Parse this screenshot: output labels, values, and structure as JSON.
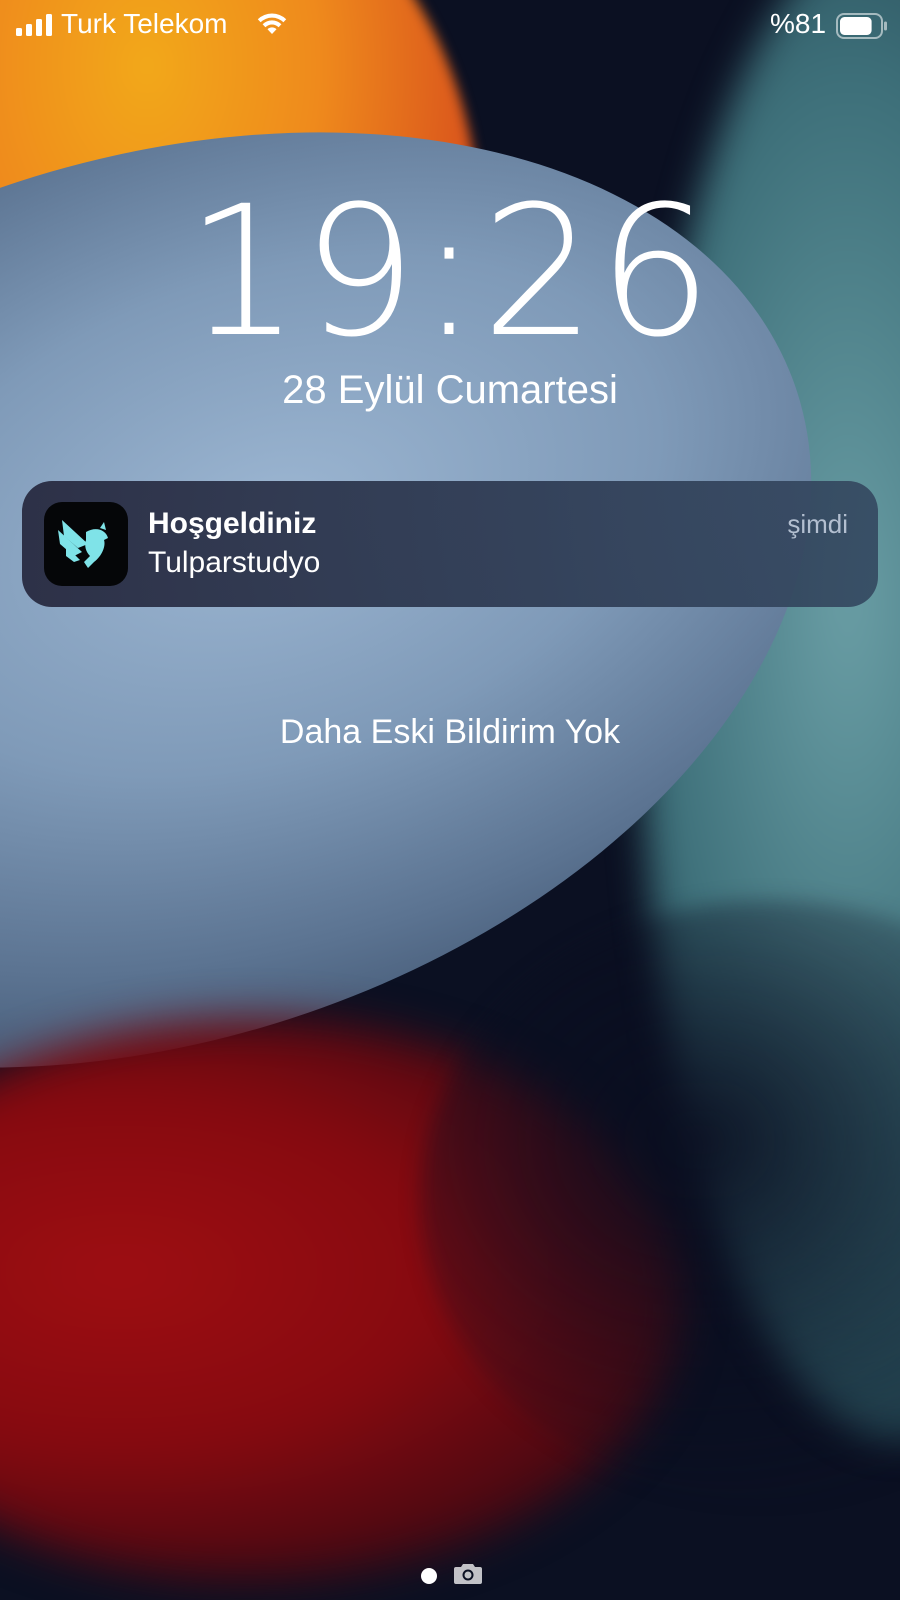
{
  "status_bar": {
    "carrier": "Turk Telekom",
    "battery_percent": "%81",
    "battery_level": 0.81
  },
  "lock_screen": {
    "time": "19:26",
    "date": "28 Eylül Cumartesi"
  },
  "notification": {
    "title": "Hoşgeldiniz",
    "body": "Tulparstudyo",
    "time": "şimdi",
    "app_icon": "pegasus-logo-icon",
    "accent_color": "#7fe3e8"
  },
  "no_older_notifications": "Daha Eski Bildirim Yok",
  "page_indicator": {
    "dot_icon": "page-dot-icon",
    "camera_icon": "camera-icon"
  }
}
